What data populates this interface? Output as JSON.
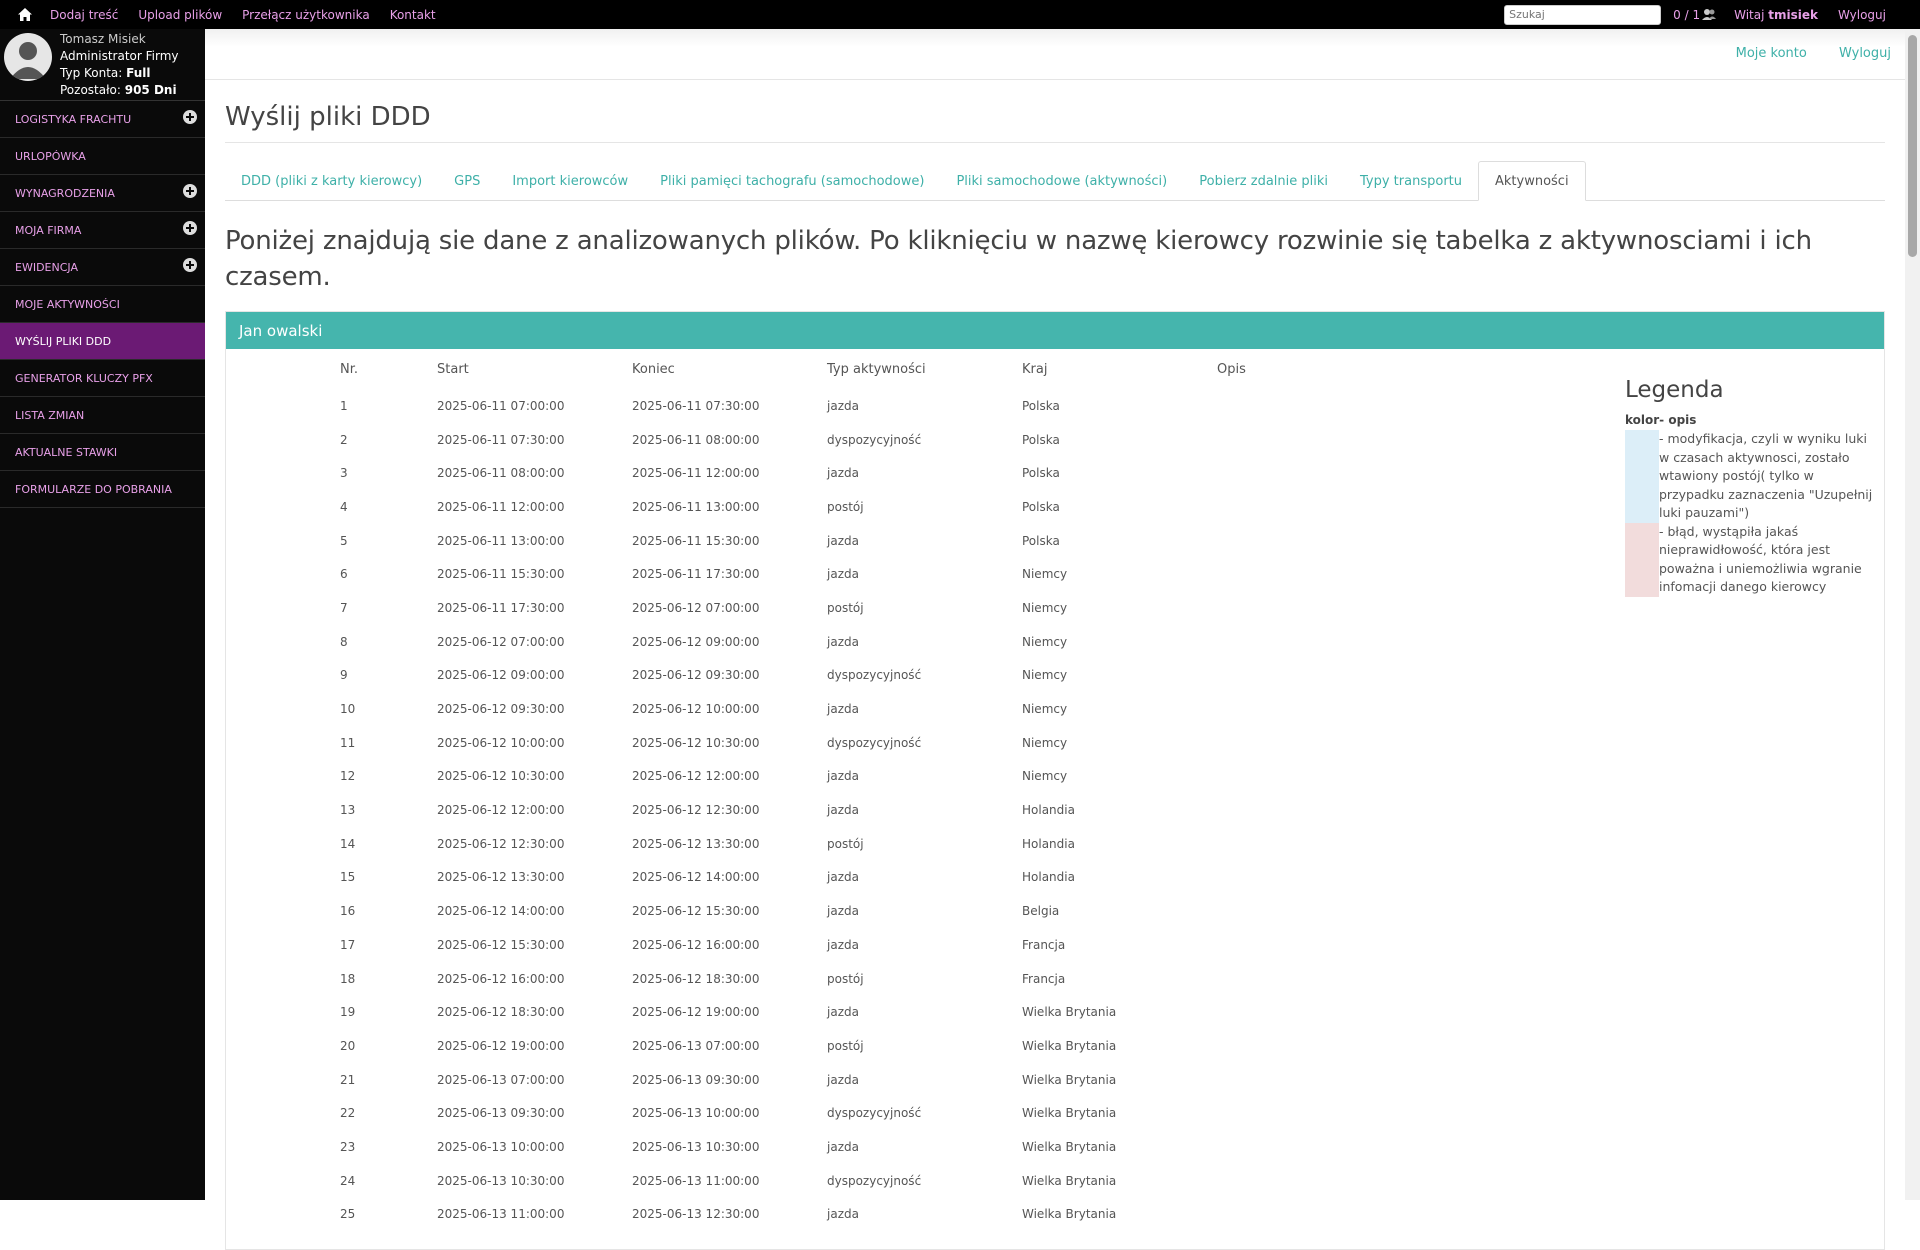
{
  "topbar": {
    "links": [
      "Dodaj treść",
      "Upload plików",
      "Przełącz użytkownika",
      "Kontakt"
    ],
    "search_placeholder": "Szukaj",
    "counter": "0 / 1",
    "welcome_prefix": "Witaj",
    "username": "tmisiek",
    "logout": "Wyloguj"
  },
  "profile": {
    "name": "Tomasz Misiek",
    "role": "Administrator Firmy",
    "account_type_label": "Typ Konta:",
    "account_type": "Full",
    "remaining_label": "Pozostało:",
    "remaining": "905 Dni"
  },
  "sidebar": {
    "items": [
      {
        "label": "LOGISTYKA FRACHTU",
        "expandable": true
      },
      {
        "label": "URLOPÓWKA",
        "expandable": false
      },
      {
        "label": "WYNAGRODZENIA",
        "expandable": true
      },
      {
        "label": "MOJA FIRMA",
        "expandable": true
      },
      {
        "label": "EWIDENCJA",
        "expandable": true
      },
      {
        "label": "MOJE AKTYWNOŚCI",
        "expandable": false
      },
      {
        "label": "WYŚLIJ PLIKI DDD",
        "expandable": false,
        "active": true
      },
      {
        "label": "GENERATOR KLUCZY PFX",
        "expandable": false
      },
      {
        "label": "LISTA ZMIAN",
        "expandable": false
      },
      {
        "label": "AKTUALNE STAWKI",
        "expandable": false
      },
      {
        "label": "FORMULARZE DO POBRANIA",
        "expandable": false
      }
    ]
  },
  "subheader": {
    "account": "Moje konto",
    "logout": "Wyloguj"
  },
  "page": {
    "title": "Wyślij pliki DDD",
    "tabs": [
      {
        "label": "DDD (pliki z karty kierowcy)"
      },
      {
        "label": "GPS"
      },
      {
        "label": "Import kierowców"
      },
      {
        "label": "Pliki pamięci tachografu (samochodowe)"
      },
      {
        "label": "Pliki samochodowe (aktywności)"
      },
      {
        "label": "Pobierz zdalnie pliki"
      },
      {
        "label": "Typy transportu"
      },
      {
        "label": "Aktywności",
        "active": true
      }
    ],
    "intro": "Poniżej znajdują sie dane z analizowanych plików. Po kliknięciu w nazwę kierowcy rozwinie się tabelka z aktywnosciami i ich czasem."
  },
  "driver": {
    "name": "Jan owalski",
    "columns": [
      "Nr.",
      "Start",
      "Koniec",
      "Typ aktywności",
      "Kraj",
      "Opis"
    ],
    "rows": [
      [
        "1",
        "2025-06-11 07:00:00",
        "2025-06-11 07:30:00",
        "jazda",
        "Polska",
        ""
      ],
      [
        "2",
        "2025-06-11 07:30:00",
        "2025-06-11 08:00:00",
        "dyspozycyjność",
        "Polska",
        ""
      ],
      [
        "3",
        "2025-06-11 08:00:00",
        "2025-06-11 12:00:00",
        "jazda",
        "Polska",
        ""
      ],
      [
        "4",
        "2025-06-11 12:00:00",
        "2025-06-11 13:00:00",
        "postój",
        "Polska",
        ""
      ],
      [
        "5",
        "2025-06-11 13:00:00",
        "2025-06-11 15:30:00",
        "jazda",
        "Polska",
        ""
      ],
      [
        "6",
        "2025-06-11 15:30:00",
        "2025-06-11 17:30:00",
        "jazda",
        "Niemcy",
        ""
      ],
      [
        "7",
        "2025-06-11 17:30:00",
        "2025-06-12 07:00:00",
        "postój",
        "Niemcy",
        ""
      ],
      [
        "8",
        "2025-06-12 07:00:00",
        "2025-06-12 09:00:00",
        "jazda",
        "Niemcy",
        ""
      ],
      [
        "9",
        "2025-06-12 09:00:00",
        "2025-06-12 09:30:00",
        "dyspozycyjność",
        "Niemcy",
        ""
      ],
      [
        "10",
        "2025-06-12 09:30:00",
        "2025-06-12 10:00:00",
        "jazda",
        "Niemcy",
        ""
      ],
      [
        "11",
        "2025-06-12 10:00:00",
        "2025-06-12 10:30:00",
        "dyspozycyjność",
        "Niemcy",
        ""
      ],
      [
        "12",
        "2025-06-12 10:30:00",
        "2025-06-12 12:00:00",
        "jazda",
        "Niemcy",
        ""
      ],
      [
        "13",
        "2025-06-12 12:00:00",
        "2025-06-12 12:30:00",
        "jazda",
        "Holandia",
        ""
      ],
      [
        "14",
        "2025-06-12 12:30:00",
        "2025-06-12 13:30:00",
        "postój",
        "Holandia",
        ""
      ],
      [
        "15",
        "2025-06-12 13:30:00",
        "2025-06-12 14:00:00",
        "jazda",
        "Holandia",
        ""
      ],
      [
        "16",
        "2025-06-12 14:00:00",
        "2025-06-12 15:30:00",
        "jazda",
        "Belgia",
        ""
      ],
      [
        "17",
        "2025-06-12 15:30:00",
        "2025-06-12 16:00:00",
        "jazda",
        "Francja",
        ""
      ],
      [
        "18",
        "2025-06-12 16:00:00",
        "2025-06-12 18:30:00",
        "postój",
        "Francja",
        ""
      ],
      [
        "19",
        "2025-06-12 18:30:00",
        "2025-06-12 19:00:00",
        "jazda",
        "Wielka Brytania",
        ""
      ],
      [
        "20",
        "2025-06-12 19:00:00",
        "2025-06-13 07:00:00",
        "postój",
        "Wielka Brytania",
        ""
      ],
      [
        "21",
        "2025-06-13 07:00:00",
        "2025-06-13 09:30:00",
        "jazda",
        "Wielka Brytania",
        ""
      ],
      [
        "22",
        "2025-06-13 09:30:00",
        "2025-06-13 10:00:00",
        "dyspozycyjność",
        "Wielka Brytania",
        ""
      ],
      [
        "23",
        "2025-06-13 10:00:00",
        "2025-06-13 10:30:00",
        "jazda",
        "Wielka Brytania",
        ""
      ],
      [
        "24",
        "2025-06-13 10:30:00",
        "2025-06-13 11:00:00",
        "dyspozycyjność",
        "Wielka Brytania",
        ""
      ],
      [
        "25",
        "2025-06-13 11:00:00",
        "2025-06-13 12:30:00",
        "jazda",
        "Wielka Brytania",
        ""
      ]
    ]
  },
  "legend": {
    "title": "Legenda",
    "header": "kolor- opis",
    "items": [
      {
        "color": "#dceef8",
        "text": "- modyfikacja, czyli w wyniku luki w czasach aktywnosci, zostało wtawiony postój( tylko w przypadku zaznaczenia \"Uzupełnij luki pauzami\")"
      },
      {
        "color": "#f2dcdc",
        "text": "- błąd, wystąpiła jakaś nieprawidłowość, która jest poważna i uniemożliwia wgranie infomacji danego kierowcy"
      }
    ]
  },
  "colors": {
    "topbar_bg": "#000000",
    "link_pink": "#e8a0e8",
    "sidebar_active": "#6b1a74",
    "teal": "#45b5ad"
  }
}
